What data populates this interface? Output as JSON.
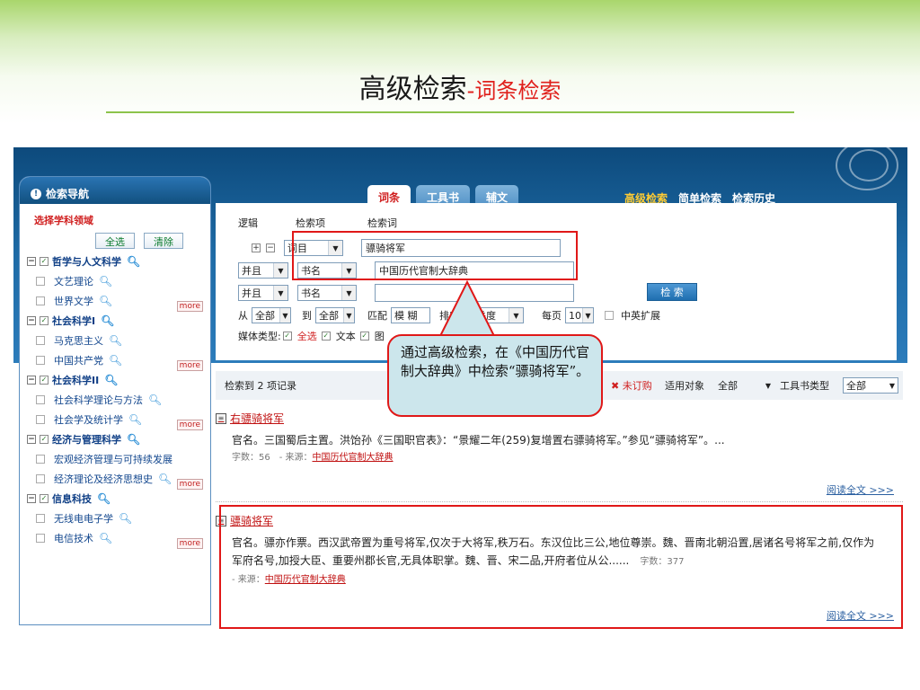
{
  "slide": {
    "title": "高级检索",
    "subtitle": "-词条检索"
  },
  "sidebar": {
    "header": "检索导航",
    "select_label": "选择学科领域",
    "select_all": "全选",
    "clear": "清除",
    "more": "more",
    "categories": [
      {
        "label": "哲学与人文科学",
        "items": [
          "文艺理论",
          "世界文学"
        ]
      },
      {
        "label": "社会科学I",
        "items": [
          "马克思主义",
          "中国共产党"
        ]
      },
      {
        "label": "社会科学II",
        "items": [
          "社会科学理论与方法",
          "社会学及统计学"
        ]
      },
      {
        "label": "经济与管理科学",
        "items": [
          "宏观经济管理与可持续发展",
          "经济理论及经济思想史"
        ]
      },
      {
        "label": "信息科技",
        "items": [
          "无线电电子学",
          "电信技术"
        ]
      }
    ]
  },
  "tabs": [
    "词条",
    "工具书",
    "辅文"
  ],
  "top_links": [
    "高级检索",
    "简单检索",
    "检索历史"
  ],
  "search": {
    "col_logic": "逻辑",
    "col_field": "检索项",
    "col_term": "检索词",
    "row1_field": "词目",
    "row1_term": "骠骑将军",
    "row2_logic": "并且",
    "row2_field": "书名",
    "row2_term": "中国历代官制大辞典",
    "row3_logic": "并且",
    "row3_field": "书名",
    "search_button": "检 索",
    "from_label": "从",
    "from_value": "全部",
    "to_label": "到",
    "to_value": "全部",
    "match_label": "匹配",
    "match_value": "模 糊",
    "sort_label": "排序",
    "sort_value": "相关度",
    "per_page_label": "每页",
    "per_page_value": "10",
    "cn_en_label": "中英扩展",
    "media_label": "媒体类型:",
    "media_all": "全选",
    "media_text": "文本",
    "media_image": "图"
  },
  "results_bar": {
    "count_text": "检索到 2 项记录",
    "unsubscribed": "未订购",
    "audience_label": "适用对象",
    "audience_value": "全部",
    "booktype_label": "工具书类型",
    "booktype_value": "全部"
  },
  "results": [
    {
      "title": "右骠骑将军",
      "body": "官名。三国蜀后主置。洪饴孙《三国职官表》：“景耀二年(259)复增置右骠骑将军。”参见“骠骑将军”。...",
      "meta": "字数：56　- 来源：",
      "source": "中国历代官制大辞典",
      "read_more": "阅读全文 >>>"
    },
    {
      "title": "骠骑将军",
      "body": "官名。骠亦作票。西汉武帝置为重号将军,仅次于大将军,秩万石。东汉位比三公,地位尊崇。魏、晋南北朝沿置,居诸名号将军之前,仅作为军府名号,加授大臣、重要州郡长官,无具体职掌。魏、晋、宋二品,开府者位从公......",
      "wordcount": "字数：377",
      "source_label": "- 来源：",
      "source": "中国历代官制大辞典",
      "read_more": "阅读全文 >>>"
    }
  ],
  "callout": "通过高级检索，在《中国历代官制大辞典》中检索“骠骑将军”。",
  "colors": {
    "accent_red": "#e01818",
    "header_blue": "#1e6ba6",
    "slide_green": "#8cc34b"
  }
}
